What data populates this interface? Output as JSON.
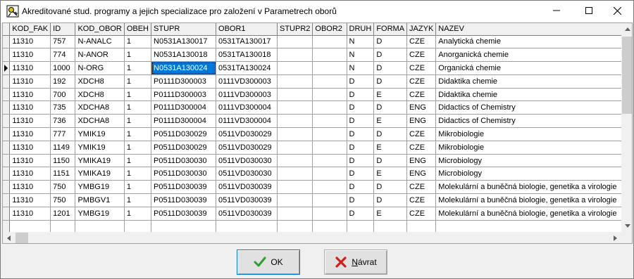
{
  "window": {
    "title": "Akreditované stud. programy a jejich specializace pro založení v Parametrech oborů",
    "minimize_glyph": "—",
    "maximize_glyph": "☐",
    "close_glyph": "✕"
  },
  "grid": {
    "columns": [
      "KOD_FAK",
      "ID",
      "KOD_OBOR",
      "OBEH",
      "STUPR",
      "OBOR1",
      "STUPR2",
      "OBOR2",
      "DRUH",
      "FORMA",
      "JAZYK",
      "NAZEV"
    ],
    "current_row": 2,
    "selected_column": 4,
    "rows": [
      [
        "11310",
        "757",
        "N-ANALC",
        "1",
        "N0531A130017",
        "0531TA130017",
        "",
        "",
        "N",
        "D",
        "CZE",
        "Analytická chemie"
      ],
      [
        "11310",
        "774",
        "N-ANOR",
        "1",
        "N0531A130018",
        "0531TA130018",
        "",
        "",
        "N",
        "D",
        "CZE",
        "Anorganická chemie"
      ],
      [
        "11310",
        "1000",
        "N-ORG",
        "1",
        "N0531A130024",
        "0531TA130024",
        "",
        "",
        "N",
        "D",
        "CZE",
        "Organická chemie"
      ],
      [
        "11310",
        "192",
        "XDCH8",
        "1",
        "P0111D300003",
        "0111VD300003",
        "",
        "",
        "D",
        "D",
        "CZE",
        "Didaktika chemie"
      ],
      [
        "11310",
        "700",
        "XDCH8",
        "1",
        "P0111D300003",
        "0111VD300003",
        "",
        "",
        "D",
        "E",
        "CZE",
        "Didaktika chemie"
      ],
      [
        "11310",
        "735",
        "XDCHA8",
        "1",
        "P0111D300004",
        "0111VD300004",
        "",
        "",
        "D",
        "D",
        "ENG",
        "Didactics of  Chemistry"
      ],
      [
        "11310",
        "736",
        "XDCHA8",
        "1",
        "P0111D300004",
        "0111VD300004",
        "",
        "",
        "D",
        "E",
        "ENG",
        "Didactics of  Chemistry"
      ],
      [
        "11310",
        "777",
        "YMIK19",
        "1",
        "P0511D030029",
        "0511VD030029",
        "",
        "",
        "D",
        "D",
        "CZE",
        "Mikrobiologie"
      ],
      [
        "11310",
        "1149",
        "YMIK19",
        "1",
        "P0511D030029",
        "0511VD030029",
        "",
        "",
        "D",
        "E",
        "CZE",
        "Mikrobiologie"
      ],
      [
        "11310",
        "1150",
        "YMIKA19",
        "1",
        "P0511D030030",
        "0511VD030030",
        "",
        "",
        "D",
        "D",
        "ENG",
        "Microbiology"
      ],
      [
        "11310",
        "1151",
        "YMIKA19",
        "1",
        "P0511D030030",
        "0511VD030030",
        "",
        "",
        "D",
        "E",
        "ENG",
        "Microbiology"
      ],
      [
        "11310",
        "750",
        "YMBG19",
        "1",
        "P0511D030039",
        "0511VD030039",
        "",
        "",
        "D",
        "D",
        "CZE",
        "Molekulární a buněčná biologie, genetika a virologie"
      ],
      [
        "11310",
        "750",
        "PMBGV1",
        "1",
        "P0511D030039",
        "0511VD030039",
        "",
        "",
        "D",
        "D",
        "CZE",
        "Molekulární a buněčná biologie, genetika a virologie"
      ],
      [
        "11310",
        "1201",
        "YMBG19",
        "1",
        "P0511D030039",
        "0511VD030039",
        "",
        "",
        "D",
        "E",
        "CZE",
        "Molekulární a buněčná biologie, genetika a virologie"
      ]
    ],
    "partial_row": [
      "",
      "",
      "",
      "",
      "",
      "",
      "",
      "",
      "",
      "",
      "",
      ""
    ]
  },
  "buttons": {
    "ok_label": "OK",
    "cancel_label": "Návrat",
    "cancel_label_underlined": "N",
    "cancel_label_rest": "ávrat"
  },
  "colors": {
    "selection": "#0078d7",
    "ok_check": "#2e9e2e",
    "cancel_x": "#d11f1f"
  },
  "icons": [
    "app-key-icon",
    "minimize-icon",
    "maximize-icon",
    "close-icon",
    "row-pointer-icon",
    "scroll-up-icon",
    "scroll-down-icon",
    "scroll-left-icon",
    "scroll-right-icon",
    "checkmark-icon",
    "red-x-icon"
  ]
}
